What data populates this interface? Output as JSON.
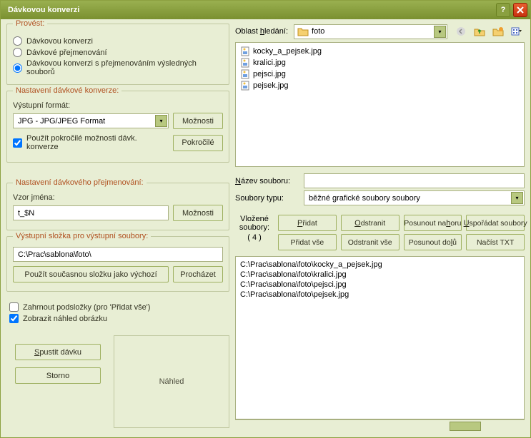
{
  "window": {
    "title": "Dávkovou konverzi"
  },
  "provest": {
    "legend": "Provést:",
    "opt1": "Dávkovou konverzi",
    "opt2": "Dávkové přejmenování",
    "opt3": "Dávkovou konverzi s přejmenováním výsledných souborů"
  },
  "konverze": {
    "legend": "Nastavení dávkové konverze:",
    "format_label": "Výstupní formát:",
    "format_value": "JPG - JPG/JPEG Format",
    "options_btn": "Možnosti",
    "advanced_check": "Použít pokročilé možnosti dávk. konverze",
    "advanced_btn": "Pokročilé"
  },
  "prejmenovani": {
    "legend": "Nastavení dávkového přejmenování:",
    "vzor_label": "Vzor jména:",
    "vzor_value": "t_$N",
    "options_btn": "Možnosti"
  },
  "vystup": {
    "legend": "Výstupní složka pro výstupní soubory:",
    "path": "C:\\Prac\\sablona\\foto\\",
    "use_current_btn": "Použít současnou složku jako výchozí",
    "browse_btn": "Procházet"
  },
  "checks": {
    "subfolders": "Zahrnout podsložky (pro 'Přidat vše')",
    "preview": "Zobrazit náhled obrázku"
  },
  "bottom": {
    "run": "Spustit dávku",
    "cancel": "Storno",
    "preview_label": "Náhled"
  },
  "search": {
    "label": "Oblast hledání:",
    "value": "foto"
  },
  "browser_files": [
    "kocky_a_pejsek.jpg",
    "kralici.jpg",
    "pejsci.jpg",
    "pejsek.jpg"
  ],
  "name": {
    "label": "Název souboru:",
    "value": ""
  },
  "filetype": {
    "label": "Soubory typu:",
    "value": "běžné grafické soubory soubory"
  },
  "vlozene": {
    "label": "Vložené soubory:",
    "count": "( 4 )"
  },
  "btns": {
    "add": "Přidat",
    "remove": "Odstranit",
    "moveup": "Posunout nahoru",
    "sort": "Uspořádat soubory",
    "addall": "Přidat vše",
    "removeall": "Odstranit vše",
    "movedn": "Posunout dolů",
    "loadtxt": "Načíst TXT"
  },
  "added_files": [
    "C:\\Prac\\sablona\\foto\\kocky_a_pejsek.jpg",
    "C:\\Prac\\sablona\\foto\\kralici.jpg",
    "C:\\Prac\\sablona\\foto\\pejsci.jpg",
    "C:\\Prac\\sablona\\foto\\pejsek.jpg"
  ]
}
